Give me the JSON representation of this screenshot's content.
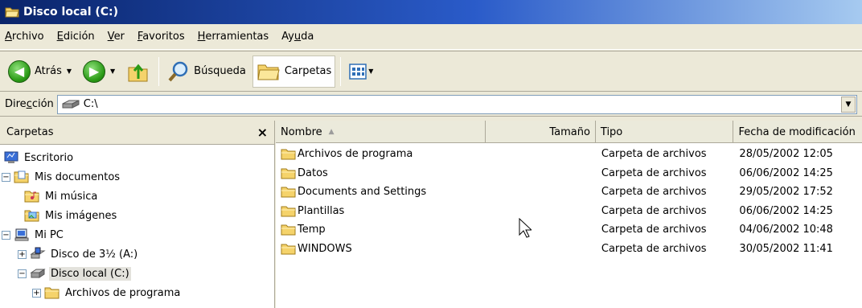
{
  "window": {
    "title": "Disco local (C:)",
    "title_icon": "folder-open-icon"
  },
  "menu": {
    "items": [
      {
        "label": "Archivo",
        "accel": "A"
      },
      {
        "label": "Edición",
        "accel": "E"
      },
      {
        "label": "Ver",
        "accel": "V"
      },
      {
        "label": "Favoritos",
        "accel": "F"
      },
      {
        "label": "Herramientas",
        "accel": "H"
      },
      {
        "label": "Ayuda",
        "accel": "u"
      }
    ]
  },
  "toolbar": {
    "back_label": "Atrás",
    "search_label": "Búsqueda",
    "folders_label": "Carpetas"
  },
  "address": {
    "label": "Dirección",
    "value": "C:\\",
    "drive_icon": "hard-drive-icon"
  },
  "folder_pane": {
    "title": "Carpetas",
    "close_glyph": "×",
    "tree": [
      {
        "label": "Escritorio",
        "icon": "desktop-icon",
        "depth": 0,
        "expander": ""
      },
      {
        "label": "Mis documentos",
        "icon": "my-documents-icon",
        "depth": 1,
        "expander": "−"
      },
      {
        "label": "Mi música",
        "icon": "my-music-icon",
        "depth": 2,
        "expander": ""
      },
      {
        "label": "Mis imágenes",
        "icon": "my-pictures-icon",
        "depth": 2,
        "expander": ""
      },
      {
        "label": "Mi PC",
        "icon": "my-computer-icon",
        "depth": 1,
        "expander": "−"
      },
      {
        "label": "Disco de 3½ (A:)",
        "icon": "floppy-drive-icon",
        "depth": 2,
        "expander": "+"
      },
      {
        "label": "Disco local (C:)",
        "icon": "hard-drive-icon",
        "depth": 2,
        "expander": "−",
        "selected": true
      },
      {
        "label": "Archivos de programa",
        "icon": "folder-icon",
        "depth": 3,
        "expander": "+"
      }
    ]
  },
  "file_list": {
    "columns": {
      "name": "Nombre",
      "size": "Tamaño",
      "type": "Tipo",
      "date": "Fecha de modificación"
    },
    "rows": [
      {
        "name": "Archivos de programa",
        "size": "",
        "type": "Carpeta de archivos",
        "date": "28/05/2002 12:05"
      },
      {
        "name": "Datos",
        "size": "",
        "type": "Carpeta de archivos",
        "date": "06/06/2002 14:25"
      },
      {
        "name": "Documents and Settings",
        "size": "",
        "type": "Carpeta de archivos",
        "date": "29/05/2002 17:52"
      },
      {
        "name": "Plantillas",
        "size": "",
        "type": "Carpeta de archivos",
        "date": "06/06/2002 14:25"
      },
      {
        "name": "Temp",
        "size": "",
        "type": "Carpeta de archivos",
        "date": "04/06/2002 10:48"
      },
      {
        "name": "WINDOWS",
        "size": "",
        "type": "Carpeta de archivos",
        "date": "30/05/2002 11:41"
      }
    ]
  },
  "colors": {
    "titlebar": "#0a246a",
    "chrome": "#ece9d8",
    "folder_yellow": "#f5d36b",
    "selection": "#e3e2dc"
  }
}
